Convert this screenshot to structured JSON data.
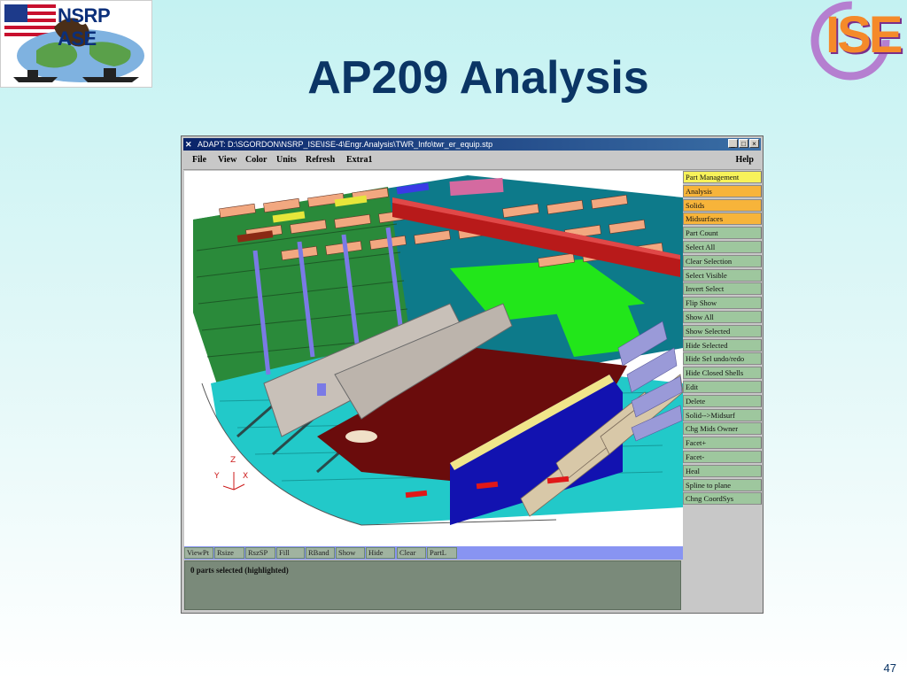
{
  "slide": {
    "title": "AP209 Analysis",
    "page_number": "47",
    "logo_left_text": "NSRP ASE",
    "logo_right_text": "ISE"
  },
  "window": {
    "title": "ADAPT: D:\\SGORDON\\NSRP_ISE\\ISE-4\\Engr.Analysis\\TWR_Info\\twr_er_equip.stp",
    "controls": [
      "_",
      "□",
      "×"
    ]
  },
  "menu": {
    "items": [
      "File",
      "View",
      "Color",
      "Units",
      "Refresh",
      "Extra1"
    ],
    "help": "Help"
  },
  "side_buttons": [
    {
      "label": "Part Management",
      "color": "#f7f25a"
    },
    {
      "label": "Analysis",
      "color": "#f7b43a"
    },
    {
      "label": "Solids",
      "color": "#f7b43a"
    },
    {
      "label": "Midsurfaces",
      "color": "#f7b43a"
    },
    {
      "label": "Part Count",
      "color": "#9ec79e"
    },
    {
      "label": "Select All",
      "color": "#9ec79e"
    },
    {
      "label": "Clear Selection",
      "color": "#9ec79e"
    },
    {
      "label": "Select Visible",
      "color": "#9ec79e"
    },
    {
      "label": "Invert Select",
      "color": "#9ec79e"
    },
    {
      "label": "Flip Show",
      "color": "#9ec79e"
    },
    {
      "label": "Show All",
      "color": "#9ec79e"
    },
    {
      "label": "Show Selected",
      "color": "#9ec79e"
    },
    {
      "label": "Hide Selected",
      "color": "#9ec79e"
    },
    {
      "label": "Hide Sel undo/redo",
      "color": "#9ec79e"
    },
    {
      "label": "Hide Closed Shells",
      "color": "#9ec79e"
    },
    {
      "label": "Edit",
      "color": "#9ec79e"
    },
    {
      "label": "Delete",
      "color": "#9ec79e"
    },
    {
      "label": "Solid-->Midsurf",
      "color": "#9ec79e"
    },
    {
      "label": "Chg Mids Owner",
      "color": "#9ec79e"
    },
    {
      "label": "Facet+",
      "color": "#9ec79e"
    },
    {
      "label": "Facet-",
      "color": "#9ec79e"
    },
    {
      "label": "Heal",
      "color": "#9ec79e"
    },
    {
      "label": "Spline to plane",
      "color": "#9ec79e"
    },
    {
      "label": "Chng CoordSys",
      "color": "#9ec79e"
    }
  ],
  "bottom_toolbar": [
    "ViewPt",
    "Rsize",
    "RszSP",
    "Fill",
    "RBand",
    "Show",
    "Hide",
    "Clear",
    "PartL"
  ],
  "status": "0 parts selected (highlighted)",
  "axes": {
    "z": "Z",
    "y": "Y",
    "x": "X"
  }
}
